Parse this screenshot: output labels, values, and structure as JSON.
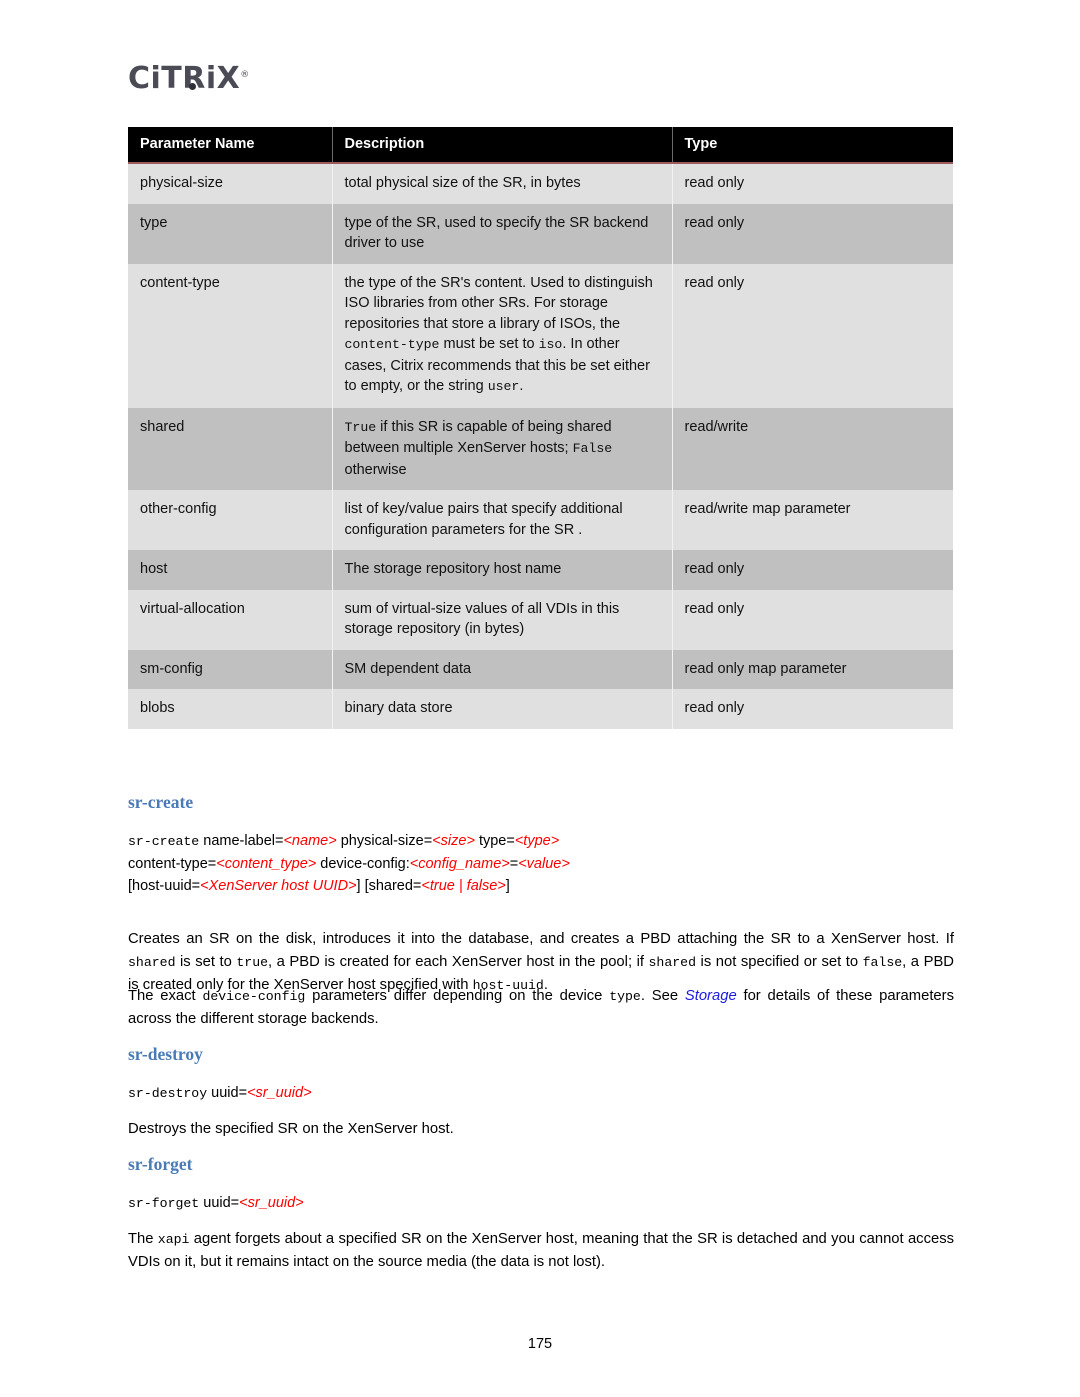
{
  "brand": {
    "logo_text": "CiTRiX",
    "logo_trademark": "®"
  },
  "table": {
    "headers": [
      "Parameter Name",
      "Description",
      "Type"
    ],
    "rows": [
      {
        "name": "physical-size",
        "desc_parts": [
          {
            "t": "total physical size of the SR, in bytes",
            "s": "plain"
          }
        ],
        "type": "read only",
        "shade": "light"
      },
      {
        "name": "type",
        "desc_parts": [
          {
            "t": "type of the SR, used to specify the SR backend driver to use",
            "s": "plain"
          }
        ],
        "type": "read only",
        "shade": "dark"
      },
      {
        "name": "content-type",
        "desc_parts": [
          {
            "t": "the type of the SR's content. Used to distinguish ISO libraries from other SRs. For storage repositories that store a library of ISOs, the ",
            "s": "plain"
          },
          {
            "t": "content-type",
            "s": "mono"
          },
          {
            "t": " must be set to ",
            "s": "plain"
          },
          {
            "t": "iso",
            "s": "mono"
          },
          {
            "t": ". In other cases, Citrix recommends that this be set either to empty, or the string ",
            "s": "plain"
          },
          {
            "t": "user",
            "s": "mono"
          },
          {
            "t": ".",
            "s": "plain"
          }
        ],
        "type": "read only",
        "shade": "light"
      },
      {
        "name": "shared",
        "desc_parts": [
          {
            "t": "True",
            "s": "mono"
          },
          {
            "t": " if this SR is capable of being shared between multiple XenServer hosts; ",
            "s": "plain"
          },
          {
            "t": "False",
            "s": "mono"
          },
          {
            "t": " otherwise",
            "s": "plain"
          }
        ],
        "type": "read/write",
        "shade": "dark"
      },
      {
        "name": "other-config",
        "desc_parts": [
          {
            "t": "list of key/value pairs that specify additional configuration parameters for the SR .",
            "s": "plain"
          }
        ],
        "type": "read/write map parameter",
        "shade": "light"
      },
      {
        "name": "host",
        "desc_parts": [
          {
            "t": "The storage repository host name",
            "s": "plain"
          }
        ],
        "type": "read only",
        "shade": "dark"
      },
      {
        "name": "virtual-allocation",
        "desc_parts": [
          {
            "t": "sum of virtual-size values of all VDIs in this storage repository (in bytes)",
            "s": "plain"
          }
        ],
        "type": "read only",
        "shade": "light"
      },
      {
        "name": "sm-config",
        "desc_parts": [
          {
            "t": "SM dependent data",
            "s": "plain"
          }
        ],
        "type": "read only map parameter",
        "shade": "dark"
      },
      {
        "name": "blobs",
        "desc_parts": [
          {
            "t": "binary data store",
            "s": "plain"
          }
        ],
        "type": "read only",
        "shade": "light"
      }
    ]
  },
  "sections": {
    "sr_create": {
      "heading": "sr-create",
      "syntax_lines": [
        [
          {
            "t": "sr-create",
            "s": "mono"
          },
          {
            "t": " name-label=",
            "s": "plain"
          },
          {
            "t": "<name>",
            "s": "ph"
          },
          {
            "t": " physical-size=",
            "s": "plain"
          },
          {
            "t": "<size>",
            "s": "ph"
          },
          {
            "t": " type=",
            "s": "plain"
          },
          {
            "t": "<type>",
            "s": "ph"
          }
        ],
        [
          {
            "t": "content-type=",
            "s": "plain"
          },
          {
            "t": "<content_type>",
            "s": "ph"
          },
          {
            "t": " device-config:",
            "s": "plain"
          },
          {
            "t": "<config_name>",
            "s": "ph"
          },
          {
            "t": "=",
            "s": "plain"
          },
          {
            "t": "<value>",
            "s": "ph"
          }
        ],
        [
          {
            "t": "[host-uuid=",
            "s": "plain"
          },
          {
            "t": "<XenServer host UUID>",
            "s": "ph"
          },
          {
            "t": "] [shared=",
            "s": "plain"
          },
          {
            "t": "<true | false>",
            "s": "ph"
          },
          {
            "t": "]",
            "s": "plain"
          }
        ]
      ],
      "paragraph1": [
        {
          "t": "Creates an SR on the disk, introduces it into the database, and creates a PBD attaching the SR to a XenServer host. If ",
          "s": "plain"
        },
        {
          "t": "shared",
          "s": "mono"
        },
        {
          "t": " is set to ",
          "s": "plain"
        },
        {
          "t": "true",
          "s": "mono"
        },
        {
          "t": ", a PBD is created for each XenServer host in the pool; if ",
          "s": "plain"
        },
        {
          "t": "shared",
          "s": "mono"
        },
        {
          "t": " is not specified or set to ",
          "s": "plain"
        },
        {
          "t": "false",
          "s": "mono"
        },
        {
          "t": ", a PBD is created only for the XenServer host specified with ",
          "s": "plain"
        },
        {
          "t": "host-uuid",
          "s": "mono"
        },
        {
          "t": ".",
          "s": "plain"
        }
      ],
      "paragraph2": [
        {
          "t": "The exact ",
          "s": "plain"
        },
        {
          "t": "device-config",
          "s": "mono"
        },
        {
          "t": " parameters differ depending on the device ",
          "s": "plain"
        },
        {
          "t": "type",
          "s": "mono"
        },
        {
          "t": ". See ",
          "s": "plain"
        },
        {
          "t": "Storage",
          "s": "link"
        },
        {
          "t": " for details of these parameters across the different storage backends.",
          "s": "plain"
        }
      ]
    },
    "sr_destroy": {
      "heading": "sr-destroy",
      "syntax_lines": [
        [
          {
            "t": "sr-destroy",
            "s": "mono"
          },
          {
            "t": " uuid=",
            "s": "plain"
          },
          {
            "t": "<sr_uuid>",
            "s": "ph"
          }
        ]
      ],
      "paragraph1": [
        {
          "t": "Destroys the specified SR on the XenServer host.",
          "s": "plain"
        }
      ]
    },
    "sr_forget": {
      "heading": "sr-forget",
      "syntax_lines": [
        [
          {
            "t": "sr-forget",
            "s": "mono"
          },
          {
            "t": " uuid=",
            "s": "plain"
          },
          {
            "t": "<sr_uuid>",
            "s": "ph"
          }
        ]
      ],
      "paragraph1": [
        {
          "t": "The ",
          "s": "plain"
        },
        {
          "t": "xapi",
          "s": "mono"
        },
        {
          "t": " agent forgets about a specified SR on the XenServer host, meaning that the SR is detached and you cannot access VDIs on it, but it remains intact on the source media (the data is not lost).",
          "s": "plain"
        }
      ]
    }
  },
  "footer": {
    "page_number": "175"
  },
  "colors": {
    "header_bg": "#000000",
    "row_light": "#e0e0e0",
    "row_dark": "#c0c0c0",
    "heading_blue": "#4a7ab5",
    "placeholder_red": "#ff0000",
    "link_blue": "#1a1ae0",
    "logo_gray": "#4b4b55"
  }
}
